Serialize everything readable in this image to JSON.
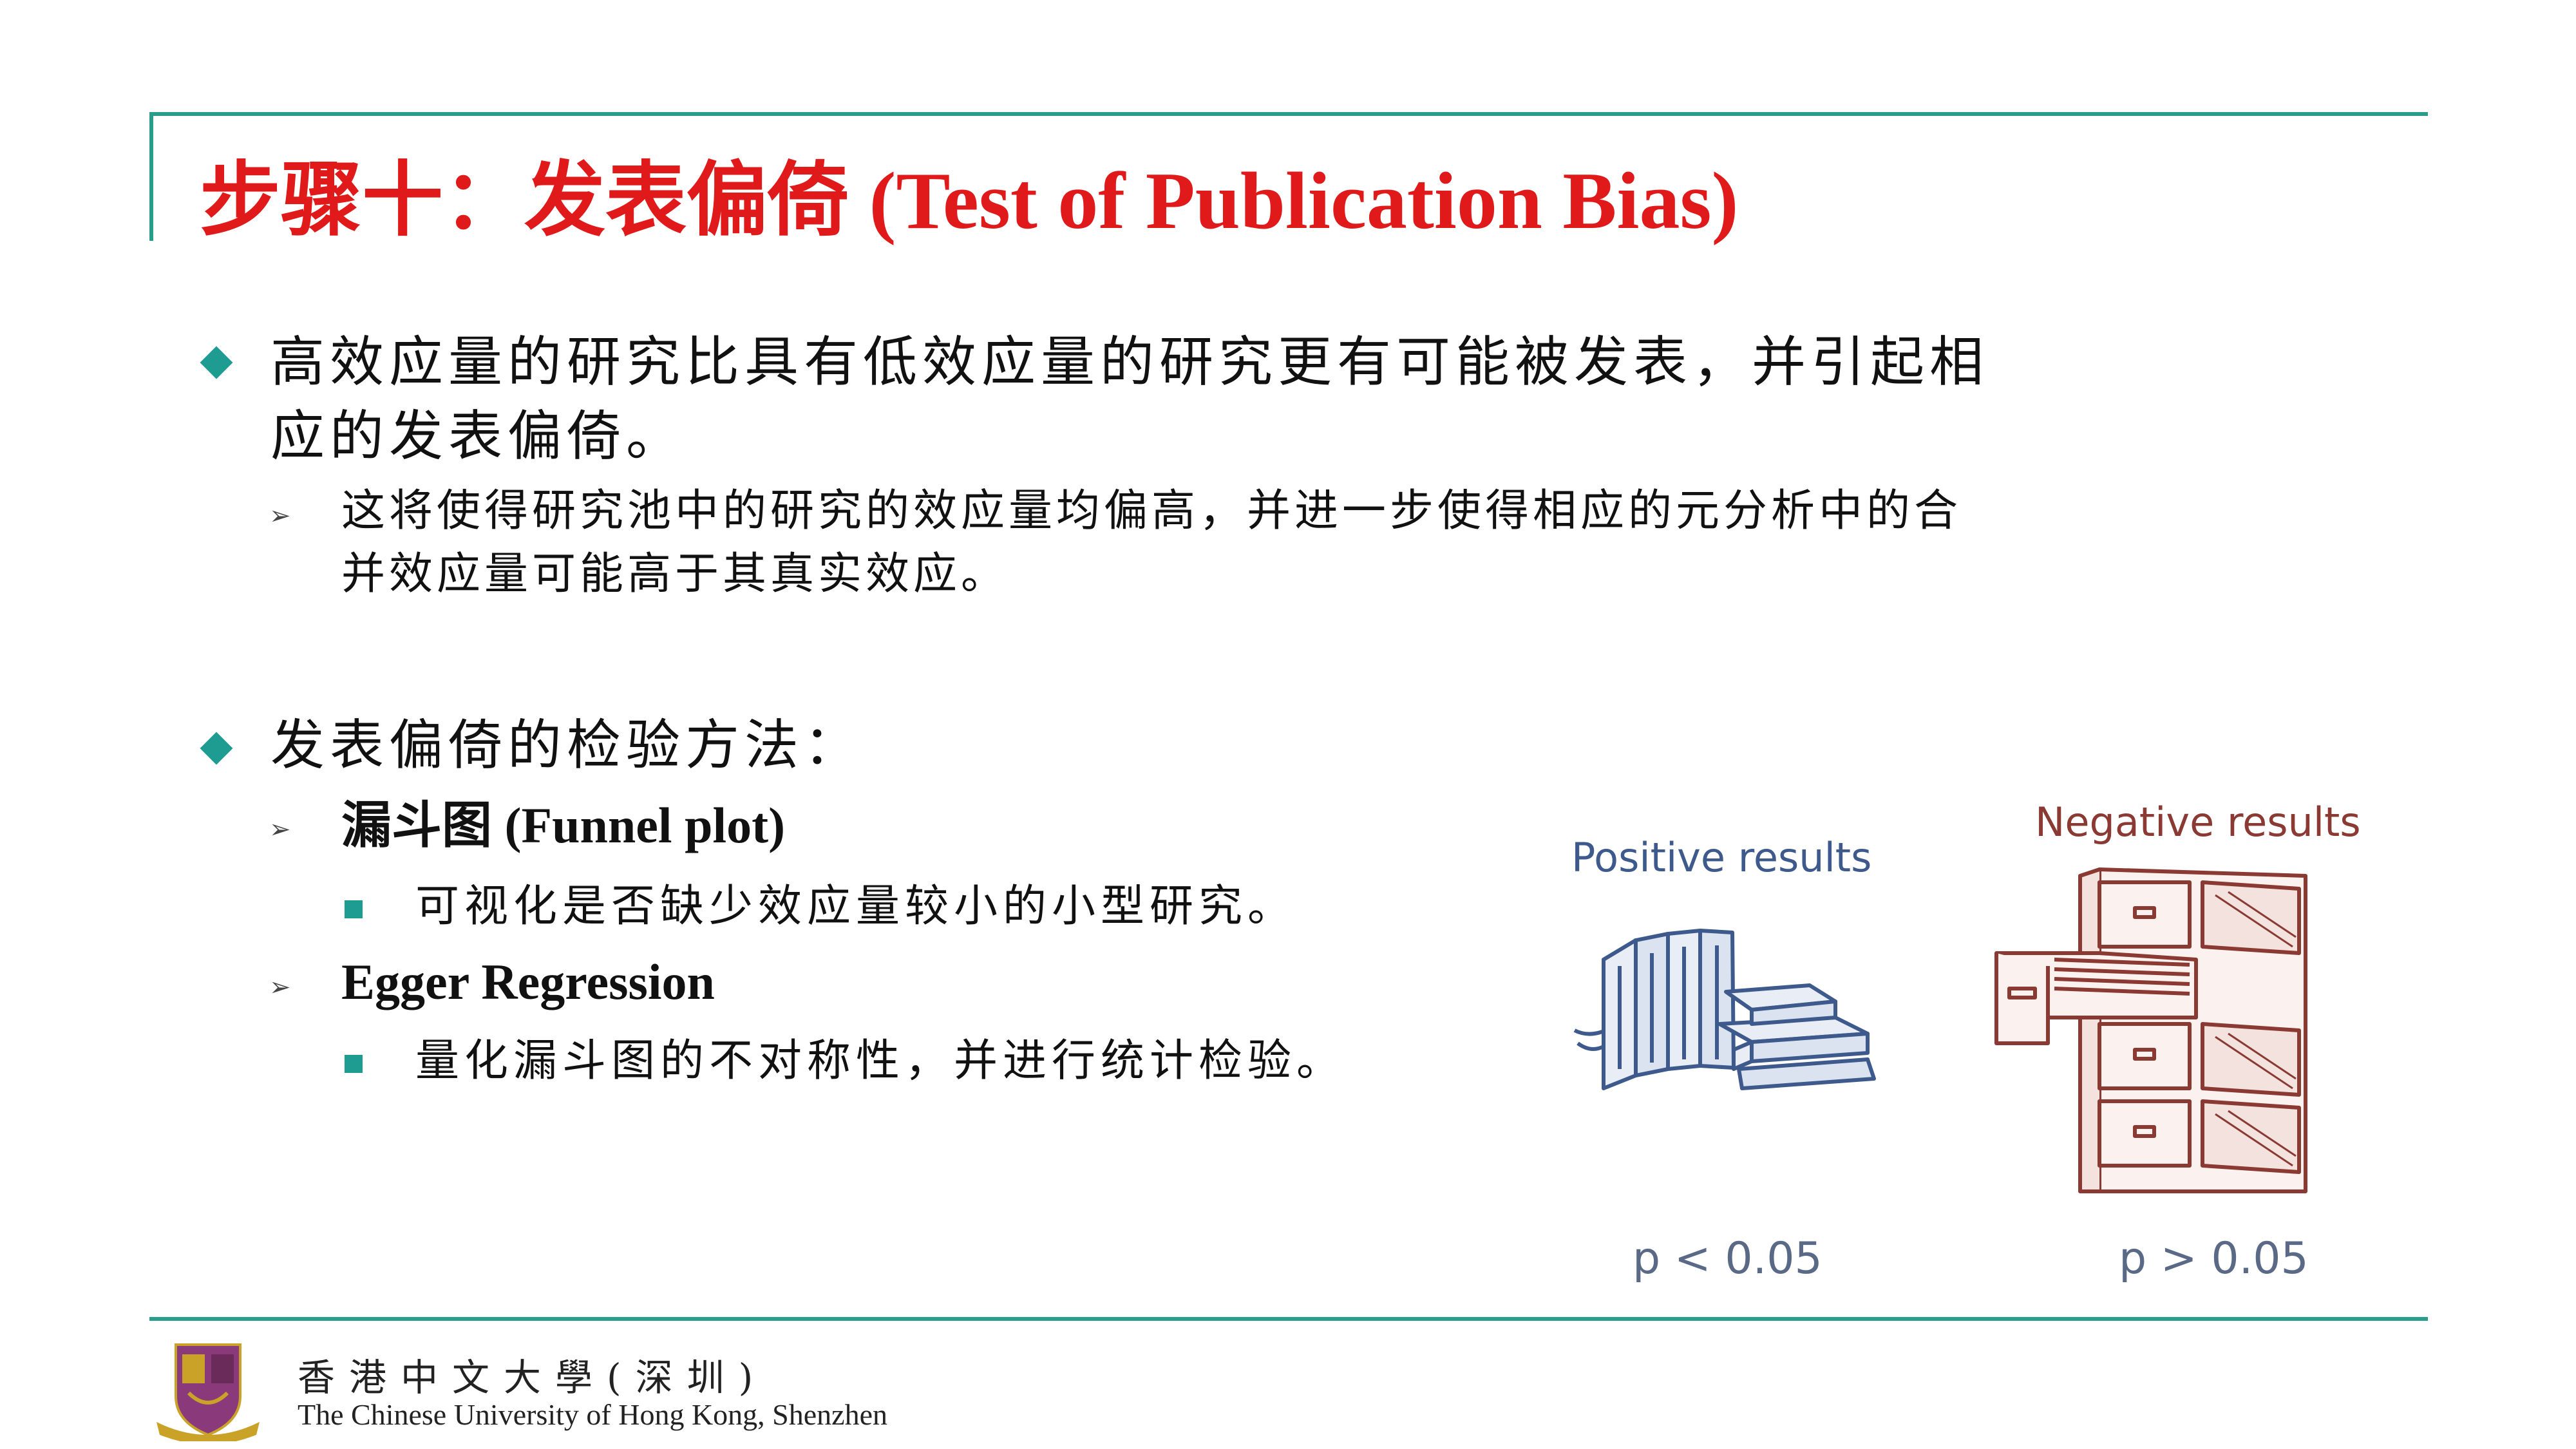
{
  "title": {
    "cn": "步骤十：发表偏倚",
    "en": " (Test of Publication Bias)"
  },
  "bullets": [
    {
      "text_line1": "高效应量的研究比具有低效应量的研究更有可能被发表，并引起相",
      "text_line2": "应的发表偏倚。",
      "sub": {
        "text_line1": "这将使得研究池中的研究的效应量均偏高，并进一步使得相应的元分析中的合",
        "text_line2": "并效应量可能高于其真实效应。"
      }
    },
    {
      "text": "发表偏倚的检验方法：",
      "methods": [
        {
          "name_cn": "漏斗图",
          "name_en": " (Funnel plot)",
          "detail": "可视化是否缺少效应量较小的小型研究。"
        },
        {
          "name_en": "Egger Regression",
          "detail": "量化漏斗图的不对称性，并进行统计检验。"
        }
      ]
    }
  ],
  "illustration": {
    "positive_label": "Positive results",
    "negative_label": "Negative results",
    "positive_p": "p < 0.05",
    "negative_p": "p > 0.05"
  },
  "footer": {
    "cn": "香港中文大學(深圳)",
    "en": "The Chinese University of Hong Kong, Shenzhen"
  },
  "colors": {
    "title": "#e01a1a",
    "rule": "#2a9c8c",
    "bullet": "#1e9c92",
    "positive": "#3e5a8c",
    "negative": "#8a3a32"
  }
}
